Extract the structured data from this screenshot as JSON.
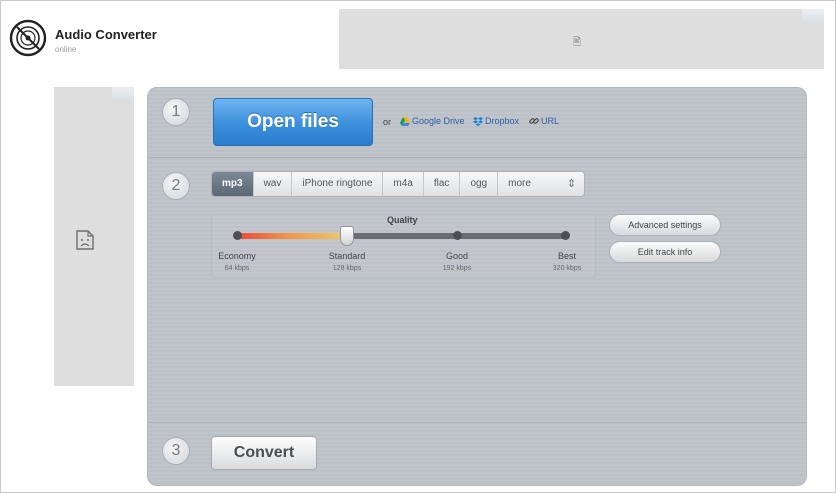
{
  "header": {
    "title": "Audio Converter",
    "subtitle": "online"
  },
  "ads": {
    "top_icon": "broken-image-icon",
    "left_icon": "broken-image-icon"
  },
  "steps": {
    "one": "1",
    "two": "2",
    "three": "3"
  },
  "open": {
    "button_label": "Open files",
    "or_text": "or",
    "sources": [
      {
        "label": "Google Drive",
        "icon": "google-drive-icon"
      },
      {
        "label": "Dropbox",
        "icon": "dropbox-icon"
      },
      {
        "label": "URL",
        "icon": "link-icon"
      }
    ]
  },
  "formats": {
    "items": [
      "mp3",
      "wav",
      "iPhone ringtone",
      "m4a",
      "flac",
      "ogg"
    ],
    "selected": "mp3",
    "more_label": "more"
  },
  "quality": {
    "title": "Quality",
    "selected_index": 1,
    "levels": [
      {
        "label": "Economy",
        "kbps": "64 kbps"
      },
      {
        "label": "Standard",
        "kbps": "128 kbps"
      },
      {
        "label": "Good",
        "kbps": "192 kbps"
      },
      {
        "label": "Best",
        "kbps": "320 kbps"
      }
    ]
  },
  "settings": {
    "advanced_label": "Advanced settings",
    "edit_track_label": "Edit track info"
  },
  "convert": {
    "button_label": "Convert"
  },
  "colors": {
    "primary_button": "#3b8fdc",
    "panel_bg": "#c0c4cb",
    "link": "#2f5fa8"
  }
}
